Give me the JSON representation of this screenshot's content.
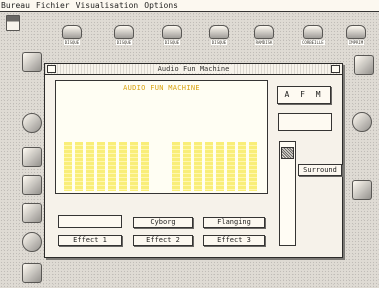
{
  "menu": [
    "Bureau",
    "Fichier",
    "Visualisation",
    "Options"
  ],
  "top_icons": [
    {
      "name": "disk",
      "label": ""
    },
    {
      "name": "drive-1",
      "label": "DISQUE"
    },
    {
      "name": "drive-2",
      "label": "DISQUE"
    },
    {
      "name": "drive-3",
      "label": "DISQUE"
    },
    {
      "name": "drive-4",
      "label": "DISQUE"
    },
    {
      "name": "drive-5",
      "label": "RAMDISK"
    },
    {
      "name": "drive-6",
      "label": "CORBEILLE"
    },
    {
      "name": "drive-7",
      "label": "IMPRIM"
    }
  ],
  "window": {
    "title": "Audio Fun Machine"
  },
  "analyzer": {
    "title": "AUDIO FUN MACHINE",
    "bar_color": "#f3ea6e",
    "bar_color_light": "#f7f2a8",
    "levels": [
      0.5,
      0.5,
      0.5,
      0.5,
      0.5,
      0.5,
      0.5,
      0.5,
      0.5,
      0.5,
      0.5,
      0.5,
      0.5,
      0.5,
      0.5,
      0.5
    ]
  },
  "afm_label": "A F M",
  "buttons": {
    "cyborg": "Cyborg",
    "flanging": "Flanging",
    "effect1": "Effect 1",
    "effect2": "Effect 2",
    "effect3": "Effect 3",
    "surround": "Surround"
  },
  "slider": {
    "level": 0.95
  }
}
